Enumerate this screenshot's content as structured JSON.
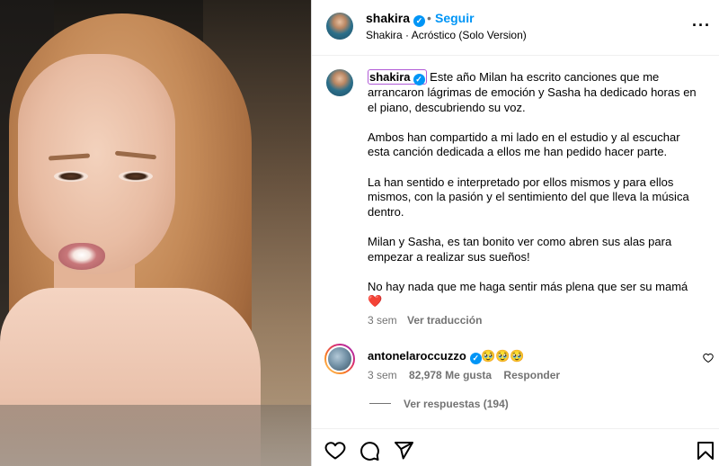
{
  "header": {
    "username": "shakira",
    "verified_glyph": "✓",
    "separator": "•",
    "follow_label": "Seguir",
    "subtitle": "Shakira · Acróstico (Solo Version)",
    "more_label": "···"
  },
  "caption": {
    "username": "shakira",
    "first_line": "Este año Milan ha escrito canciones que me arrancaron lágrimas de emoción y Sasha ha dedicado horas en el piano, descubriendo su voz.",
    "paragraphs": [
      "Ambos han compartido a mi lado en el estudio y al escuchar esta canción dedicada a ellos me han pedido hacer parte.",
      "La han sentido e interpretado por ellos mismos y para ellos mismos, con la pasión y el sentimiento del que lleva la música dentro.",
      "Milan y Sasha, es tan bonito ver como abren sus alas para empezar a realizar sus sueños!",
      "No hay nada que me haga sentir más plena que ser su mamá"
    ],
    "heart": "❤️",
    "time": "3 sem",
    "translate_label": "Ver traducción"
  },
  "comment": {
    "username": "antonelaroccuzzo",
    "text": "🥹🥹🥹",
    "time": "3 sem",
    "likes": "82,978 Me gusta",
    "reply_label": "Responder",
    "like_icon": "heart-outline-icon",
    "replies_label": "Ver respuestas (194)"
  },
  "actions": {
    "icons": [
      "heart-icon",
      "comment-icon",
      "share-icon",
      "bookmark-icon"
    ]
  }
}
